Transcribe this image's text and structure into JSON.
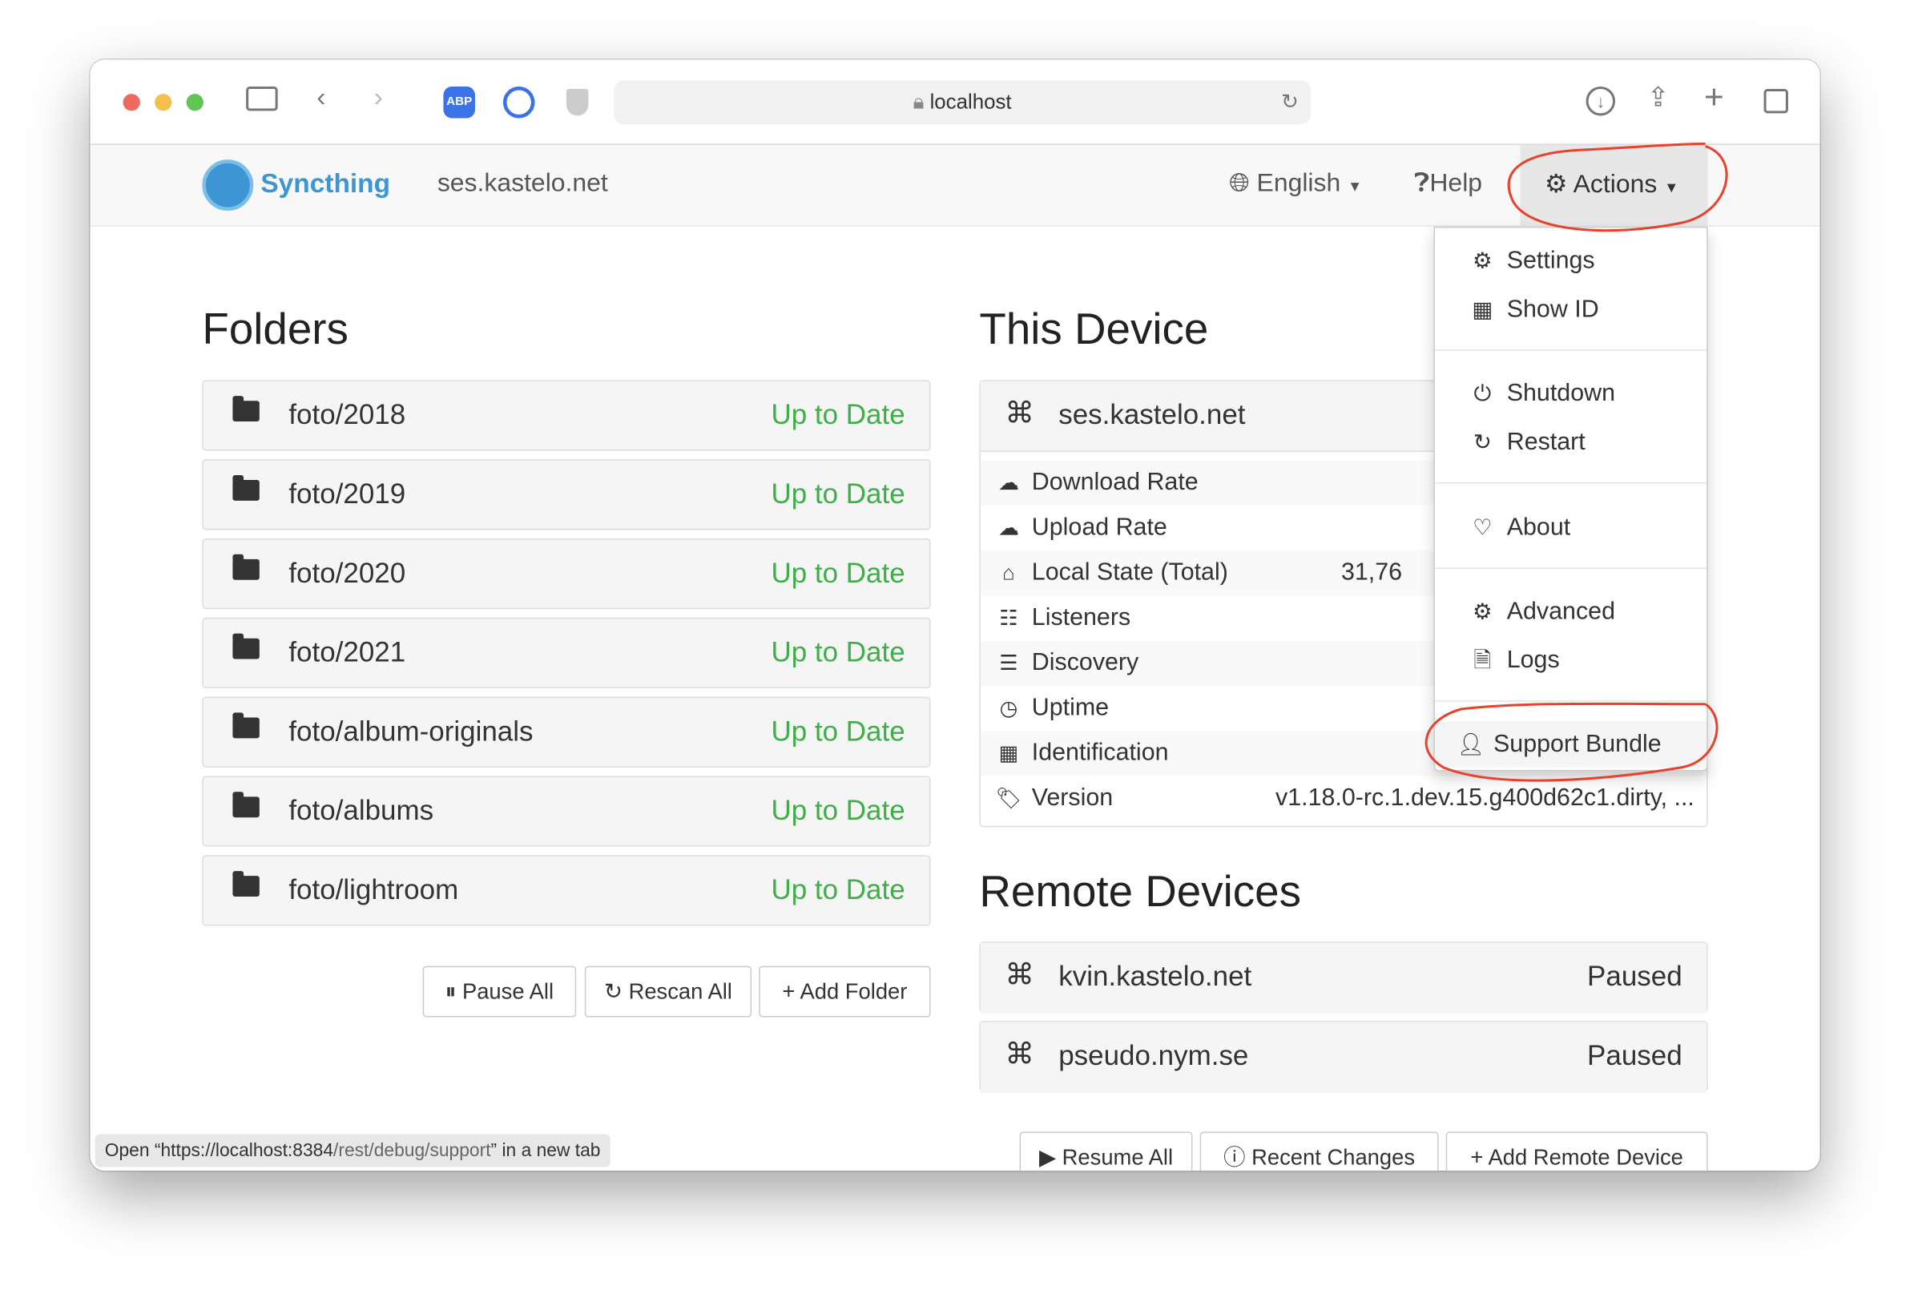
{
  "browser": {
    "url": "localhost",
    "extensions": [
      "ABP",
      "1Password",
      "Privacy shield"
    ]
  },
  "nav": {
    "brand": "Syncthing",
    "device": "ses.kastelo.net",
    "language": "English",
    "help": "Help",
    "actions": "Actions"
  },
  "folders": {
    "title": "Folders",
    "items": [
      {
        "name": "foto/2018",
        "status": "Up to Date"
      },
      {
        "name": "foto/2019",
        "status": "Up to Date"
      },
      {
        "name": "foto/2020",
        "status": "Up to Date"
      },
      {
        "name": "foto/2021",
        "status": "Up to Date"
      },
      {
        "name": "foto/album-originals",
        "status": "Up to Date"
      },
      {
        "name": "foto/albums",
        "status": "Up to Date"
      },
      {
        "name": "foto/lightroom",
        "status": "Up to Date"
      }
    ],
    "buttons": {
      "pause": "Pause All",
      "rescan": "Rescan All",
      "add": "Add Folder"
    }
  },
  "this_device": {
    "title": "This Device",
    "name": "ses.kastelo.net",
    "rows": [
      {
        "label": "Download Rate",
        "value": ""
      },
      {
        "label": "Upload Rate",
        "value": ""
      },
      {
        "label": "Local State (Total)",
        "value": "31,76"
      },
      {
        "label": "Listeners",
        "value": ""
      },
      {
        "label": "Discovery",
        "value": ""
      },
      {
        "label": "Uptime",
        "value": ""
      },
      {
        "label": "Identification",
        "value": ""
      },
      {
        "label": "Version",
        "value": "v1.18.0-rc.1.dev.15.g400d62c1.dirty, ..."
      }
    ]
  },
  "remote": {
    "title": "Remote Devices",
    "items": [
      {
        "name": "kvin.kastelo.net",
        "status": "Paused"
      },
      {
        "name": "pseudo.nym.se",
        "status": "Paused"
      }
    ],
    "buttons": {
      "resume": "Resume All",
      "recent": "Recent Changes",
      "add": "Add Remote Device"
    }
  },
  "actions_menu": [
    {
      "label": "Settings",
      "icon": "gear-icon"
    },
    {
      "label": "Show ID",
      "icon": "qrcode-icon"
    },
    {
      "label": "Shutdown",
      "icon": "power-icon"
    },
    {
      "label": "Restart",
      "icon": "refresh-icon"
    },
    {
      "label": "About",
      "icon": "heart-icon"
    },
    {
      "label": "Advanced",
      "icon": "cogs-icon"
    },
    {
      "label": "Logs",
      "icon": "file-icon"
    },
    {
      "label": "Support Bundle",
      "icon": "user-doctor-icon"
    }
  ],
  "status_bar": {
    "prefix": "Open “https://localhost:8384",
    "path": "/rest/debug/support",
    "suffix": "” in a new tab"
  },
  "colors": {
    "brand": "#3d95d4",
    "up_to_date": "#3fae49",
    "annotation": "#e8412c"
  }
}
